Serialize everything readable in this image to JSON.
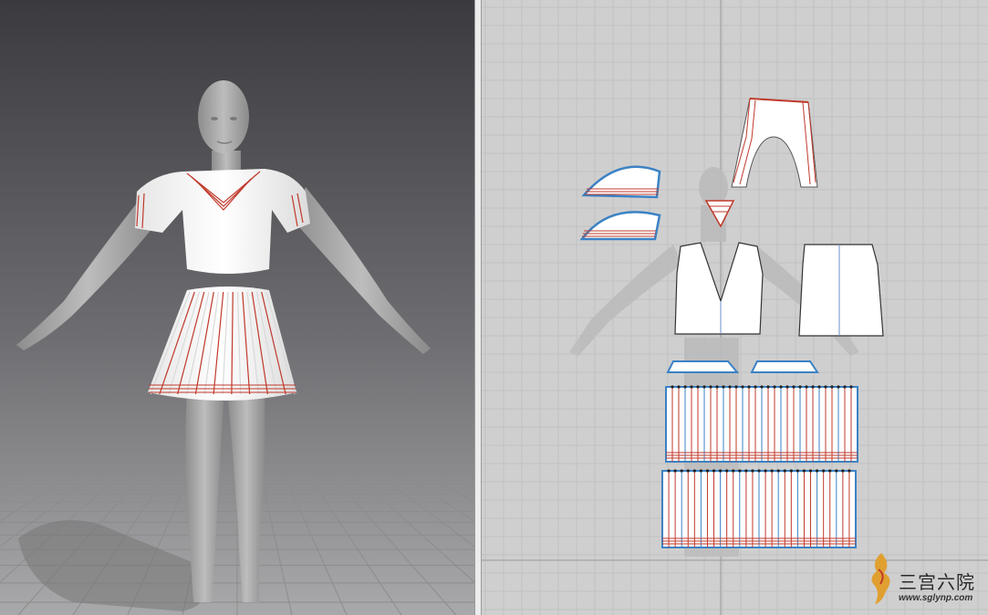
{
  "colors": {
    "viewport3d_top": "#3a3a3f",
    "viewport3d_bottom": "#a9a9ab",
    "pattern_bg": "#cfcfcf",
    "grid_line": "#bdbdbd",
    "stitch_red": "#c0392b",
    "outline_blue": "#3b82c4",
    "garment_white": "#ffffff",
    "avatar_gray": "#9c9c9c"
  },
  "viewport_3d": {
    "content": "avatar wearing sailor uniform",
    "icons": [
      "avatar-figure",
      "floor-grid-icon"
    ]
  },
  "pattern_2d": {
    "pieces": [
      "collar-top",
      "collar-bottom",
      "sleeve",
      "front-bodice",
      "back-bodice",
      "neck-insert",
      "waistband-left",
      "waistband-right",
      "skirt-front",
      "skirt-back"
    ]
  },
  "watermark": {
    "text": "三宫六院",
    "url": "www.sglynp.com"
  }
}
